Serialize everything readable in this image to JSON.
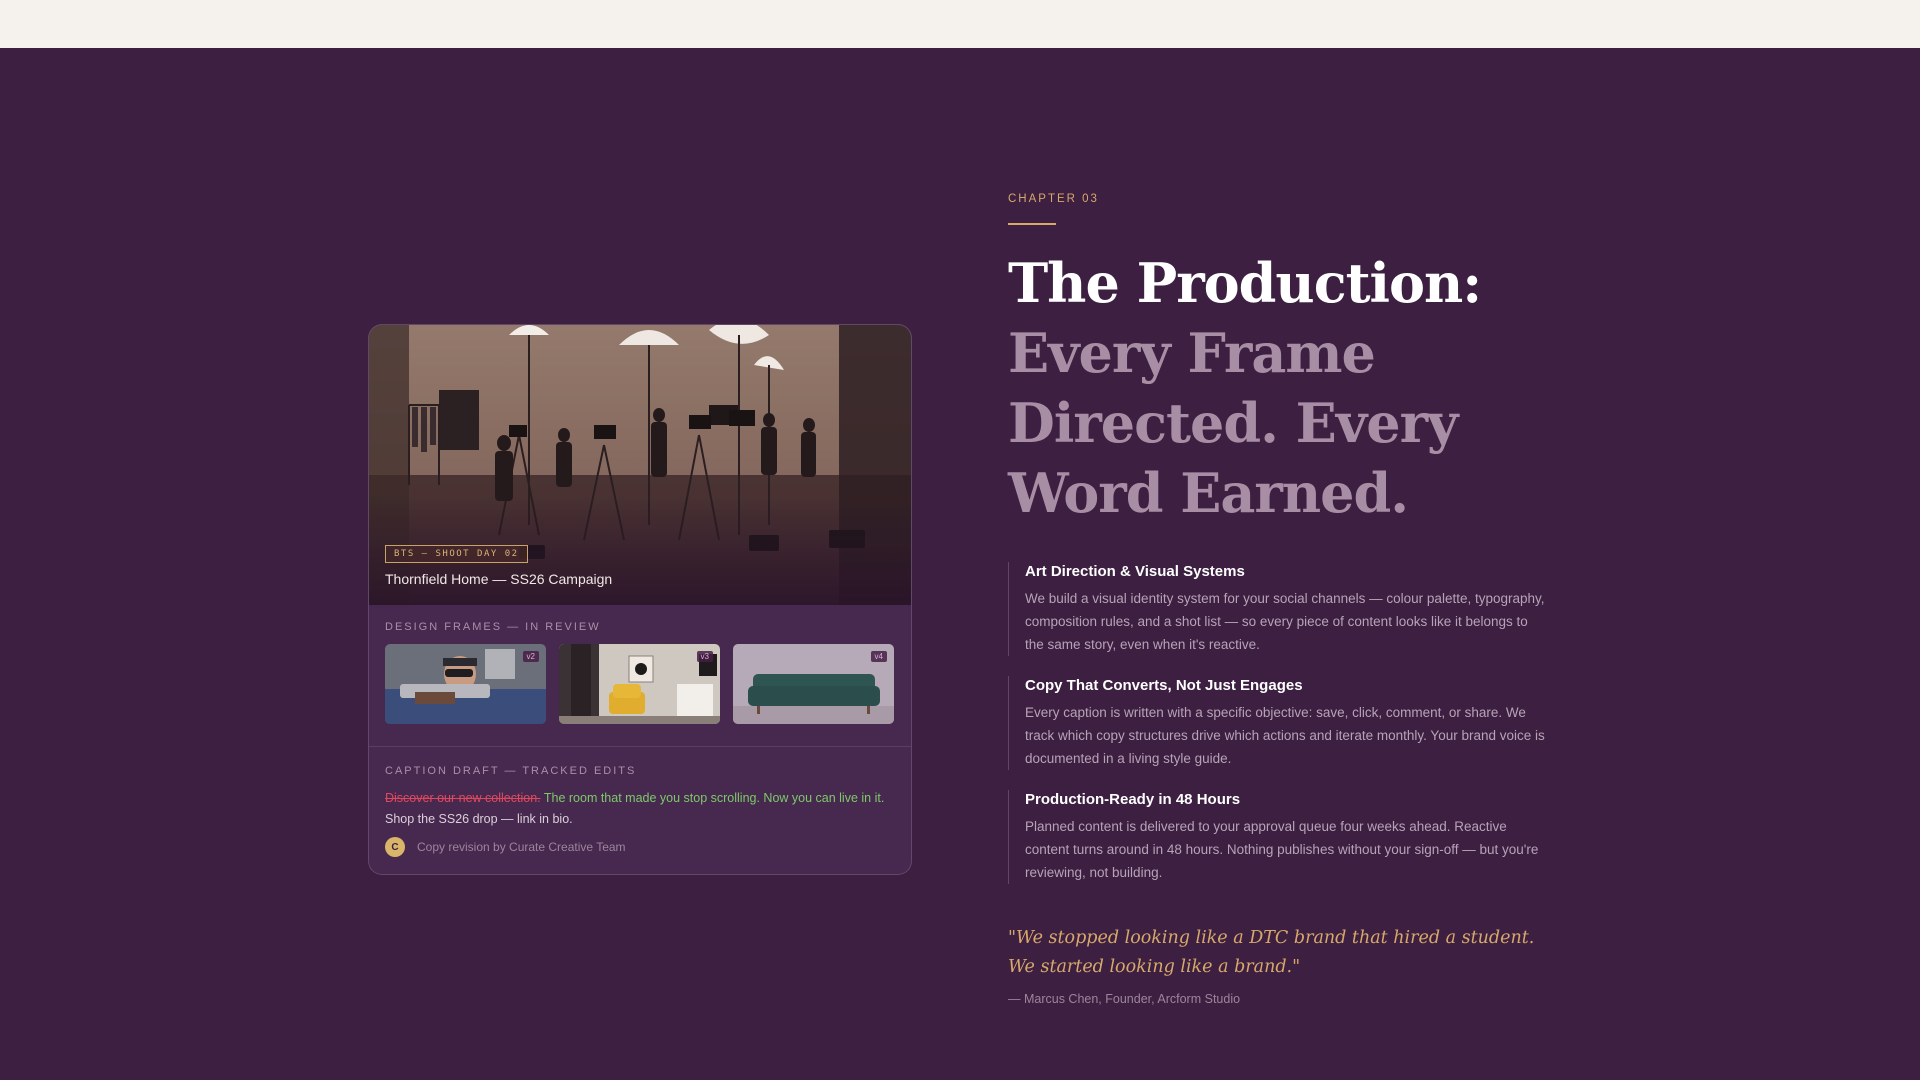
{
  "card": {
    "hero_tag": "BTS — SHOOT DAY 02",
    "hero_title": "Thornfield Home — SS26 Campaign",
    "frames_label": "DESIGN FRAMES — IN REVIEW",
    "frames": [
      {
        "badge": "v2",
        "subject": "camera-operator"
      },
      {
        "badge": "v3",
        "subject": "yellow-armchair-interior"
      },
      {
        "badge": "v4",
        "subject": "green-sofa"
      }
    ],
    "caption_label": "CAPTION DRAFT — TRACKED EDITS",
    "caption_deleted": "Discover our new collection.",
    "caption_added": "The room that made you stop scrolling. Now you can live in it.",
    "caption_rest": " Shop the SS26 drop — link in bio.",
    "revision_avatar": "C",
    "revision_text": "Copy revision by Curate Creative Team"
  },
  "chapter": {
    "label": "CHAPTER 03",
    "title_line1": "The Production:",
    "title_line2": "Every Frame",
    "title_line3": "Directed. Every",
    "title_line4": "Word Earned."
  },
  "features": [
    {
      "title": "Art Direction & Visual Systems",
      "body": "We build a visual identity system for your social channels — colour palette, typography, composition rules, and a shot list — so every piece of content looks like it belongs to the same story, even when it's reactive."
    },
    {
      "title": "Copy That Converts, Not Just Engages",
      "body": "Every caption is written with a specific objective: save, click, comment, or share. We track which copy structures drive which actions and iterate monthly. Your brand voice is documented in a living style guide."
    },
    {
      "title": "Production-Ready in 48 Hours",
      "body": "Planned content is delivered to your approval queue four weeks ahead. Reactive content turns around in 48 hours. Nothing publishes without your sign-off — but you're reviewing, not building."
    }
  ],
  "quote": {
    "text": "\"We stopped looking like a DTC brand that hired a student. We started looking like a brand.\"",
    "attribution": "— Marcus Chen, Founder, Arcform Studio"
  },
  "colors": {
    "background": "#3d1f42",
    "topbar": "#f5f1ec",
    "accent": "#d6a86a",
    "muted_title": "#a88ea5",
    "deleted": "#e0485e",
    "added": "#7ec86a"
  }
}
